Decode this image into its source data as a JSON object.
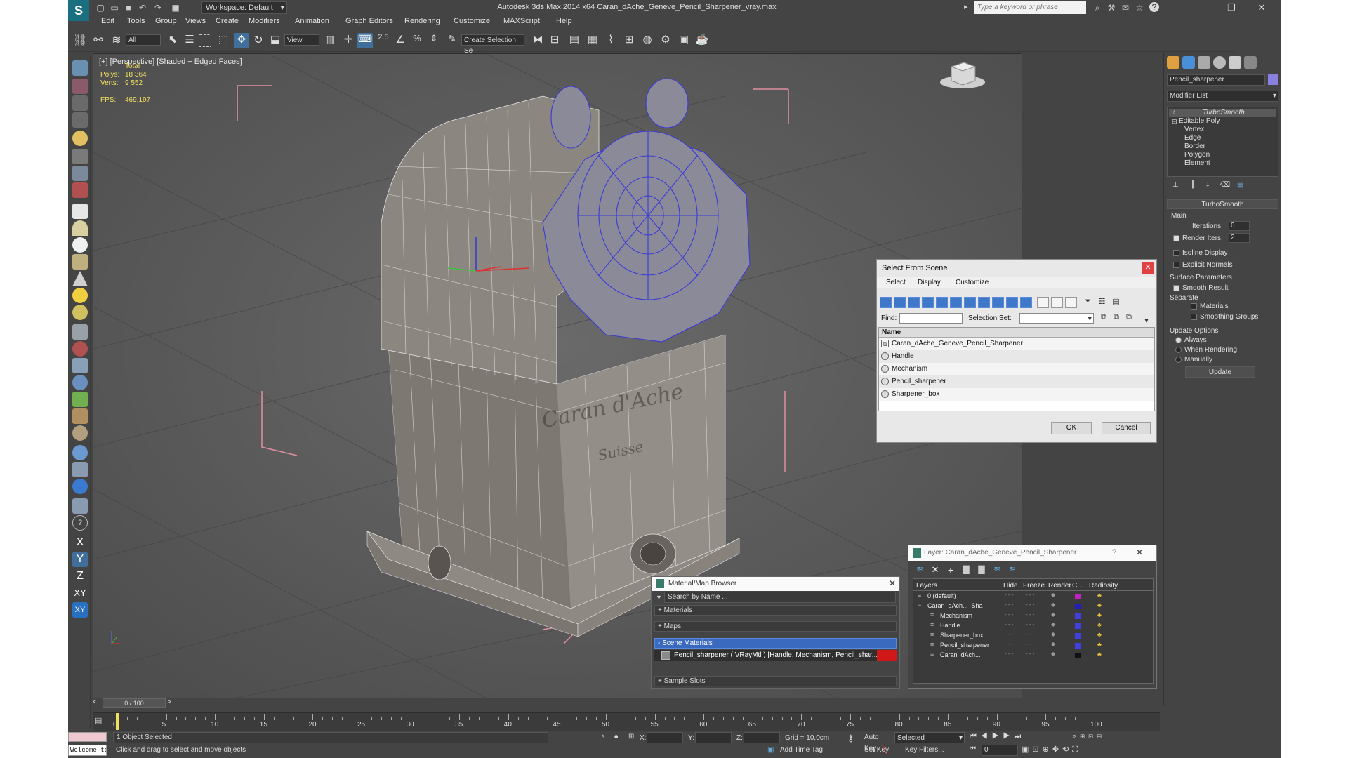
{
  "app": {
    "window_title": "Autodesk 3ds Max  2014 x64     Caran_dAche_Geneve_Pencil_Sharpener_vray.max",
    "workspace": "Workspace: Default",
    "search_placeholder": "Type a keyword or phrase"
  },
  "menu": [
    "Edit",
    "Tools",
    "Group",
    "Views",
    "Create",
    "Modifiers",
    "Animation",
    "Graph Editors",
    "Rendering",
    "Customize",
    "MAXScript",
    "Help"
  ],
  "toolbar": {
    "filter_value": "All",
    "coord_value": "View",
    "create_selection_set": "Create Selection Se",
    "snap_label": "2.5"
  },
  "viewport": {
    "label": "[+] [Perspective] [Shaded + Edged Faces]",
    "stats": {
      "header": "Total",
      "polys_label": "Polys:",
      "polys_value": "18 364",
      "verts_label": "Verts:",
      "verts_value": "9 552",
      "fps_label": "FPS:",
      "fps_value": "469,197"
    },
    "blurred_text_1": "Caran d'Ache",
    "blurred_text_2": "Suisse"
  },
  "left_tools": {
    "axis_x": "X",
    "axis_y": "Y",
    "axis_z": "Z",
    "axis_xy": "XY",
    "axis_xy2": "XY"
  },
  "command_panel": {
    "object_name": "Pencil_sharpener",
    "modifier_list": "Modifier List",
    "stack": [
      "TurboSmooth",
      "Editable Poly",
      "Vertex",
      "Edge",
      "Border",
      "Polygon",
      "Element"
    ],
    "rollout_title": "TurboSmooth",
    "main_label": "Main",
    "iterations_label": "Iterations:",
    "iterations_value": "0",
    "render_iters_label": "Render Iters:",
    "render_iters_value": "2",
    "isoline": "Isoline Display",
    "explicit_normals": "Explicit Normals",
    "surface_params": "Surface Parameters",
    "smooth_result": "Smooth Result",
    "separate": "Separate",
    "materials": "Materials",
    "smoothing_groups": "Smoothing Groups",
    "update_options": "Update Options",
    "always": "Always",
    "when_rendering": "When Rendering",
    "manually": "Manually",
    "update_button": "Update"
  },
  "select_from_scene": {
    "title": "Select From Scene",
    "menus": [
      "Select",
      "Display",
      "Customize"
    ],
    "find_label": "Find:",
    "selection_set_label": "Selection Set:",
    "column_name": "Name",
    "rows": [
      "Caran_dAche_Geneve_Pencil_Sharpener",
      "Handle",
      "Mechanism",
      "Pencil_sharpener",
      "Sharpener_box"
    ],
    "ok": "OK",
    "cancel": "Cancel"
  },
  "layer_dialog": {
    "title": "Layer: Caran_dAche_Geneve_Pencil_Sharpener",
    "help": "?",
    "columns": [
      "Layers",
      "Hide",
      "Freeze",
      "Render",
      "C...",
      "Radiosity"
    ],
    "rows": [
      {
        "name": "0 (default)",
        "color": "#c020c0"
      },
      {
        "name": "Caran_dAch..._Sha",
        "color": "#2020c0"
      },
      {
        "name": "Mechanism",
        "color": "#4040e0"
      },
      {
        "name": "Handle",
        "color": "#4040e0"
      },
      {
        "name": "Sharpener_box",
        "color": "#4040e0"
      },
      {
        "name": "Pencil_sharpener",
        "color": "#4040e0"
      },
      {
        "name": "Caran_dAch..._",
        "color": "#111111"
      }
    ]
  },
  "material_browser": {
    "title": "Material/Map Browser",
    "search": "Search by Name ...",
    "groups": [
      "+ Materials",
      "+ Maps",
      "- Scene Materials",
      "+ Sample Slots"
    ],
    "scene_material": "Pencil_sharpener  ( VRayMtl )  [Handle, Mechanism, Pencil_shar..."
  },
  "timeline": {
    "frame": "0 / 100",
    "ticks": [
      "0",
      "5",
      "10",
      "15",
      "20",
      "25",
      "30",
      "35",
      "40",
      "45",
      "50",
      "55",
      "60",
      "65",
      "70",
      "75",
      "80",
      "85",
      "90",
      "95",
      "100"
    ]
  },
  "status": {
    "maxscript": "Welcome to M",
    "selected": "1 Object Selected",
    "prompt": "Click and drag to select and move objects",
    "x_label": "X:",
    "y_label": "Y:",
    "z_label": "Z:",
    "grid": "Grid = 10,0cm",
    "auto_key": "Auto Key",
    "selected_dropdown": "Selected",
    "set_key": "Set Key",
    "key_filters": "Key Filters...",
    "add_time_tag": "Add Time Tag",
    "frame_field": "0"
  }
}
